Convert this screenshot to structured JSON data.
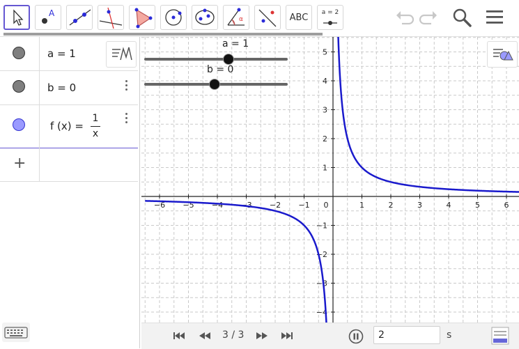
{
  "toolbar": {
    "tools": [
      {
        "name": "move-tool",
        "icon": "cursor-arrow-icon"
      },
      {
        "name": "point-tool",
        "icon": "point-icon",
        "label": "A"
      },
      {
        "name": "line-tool",
        "icon": "line-icon"
      },
      {
        "name": "perpendicular-tool",
        "icon": "perpendicular-line-icon"
      },
      {
        "name": "polygon-tool",
        "icon": "polygon-icon"
      },
      {
        "name": "circle-tool",
        "icon": "circle-center-icon"
      },
      {
        "name": "conic-tool",
        "icon": "ellipse-icon"
      },
      {
        "name": "angle-tool",
        "icon": "angle-icon",
        "label": "α"
      },
      {
        "name": "reflect-tool",
        "icon": "reflect-icon"
      },
      {
        "name": "text-tool",
        "icon": "text-icon",
        "label": "ABC"
      },
      {
        "name": "slider-tool",
        "icon": "slider-icon",
        "label": "a = 2"
      }
    ],
    "undo_icon": "undo-icon",
    "redo_icon": "redo-icon",
    "search_icon": "search-icon",
    "menu_icon": "hamburger-menu-icon"
  },
  "algebra": {
    "rows": [
      {
        "text": "a = 1",
        "marker_color": "#7f7f7f"
      },
      {
        "text": "b = 0",
        "marker_color": "#7f7f7f"
      },
      {
        "lhs": "f (x)  =",
        "numerator": "1",
        "denominator": "x",
        "marker_color": "#9a9aff"
      }
    ],
    "add_label": "+",
    "style_bar_icon": "algebra-style-icon",
    "keyboard_icon": "keyboard-icon"
  },
  "graphics": {
    "style_bar_icon": "graphics-style-icon",
    "sliders": [
      {
        "label": "a = 1",
        "value": 1,
        "min": -5,
        "max": 5
      },
      {
        "label": "b = 0",
        "value": 0,
        "min": -5,
        "max": 5
      }
    ],
    "curve_color": "#1a1acc",
    "x_ticks": [
      "−6",
      "−5",
      "−4",
      "−3",
      "−2",
      "−1",
      "0",
      "1",
      "2",
      "3",
      "4",
      "5",
      "6"
    ],
    "y_ticks": [
      "5",
      "4",
      "3",
      "2",
      "1",
      "−1",
      "−2",
      "−3",
      "−4"
    ],
    "chart_data": {
      "type": "line",
      "function": "f(x) = 1/x",
      "xlim": [
        -6.5,
        6.5
      ],
      "ylim": [
        -4.2,
        5.4
      ],
      "grid": true,
      "series": [
        {
          "name": "f",
          "formula": "1/x"
        }
      ]
    }
  },
  "player": {
    "slide_counter": "3 / 3",
    "speed_value": "2",
    "speed_unit": "s",
    "first_icon": "skip-first-icon",
    "prev_icon": "rewind-icon",
    "next_icon": "fast-forward-icon",
    "last_icon": "skip-last-icon",
    "pause_icon": "pause-icon",
    "table_icon": "properties-table-icon"
  }
}
